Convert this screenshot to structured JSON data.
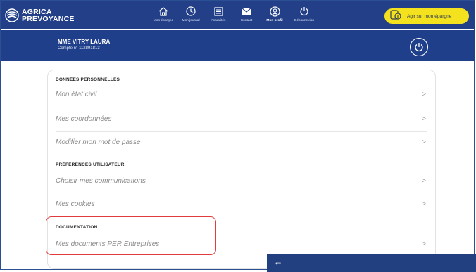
{
  "brand": {
    "line1": "AGRICA",
    "line2": "PRÉVOYANCE"
  },
  "nav": [
    {
      "label": "Mon épargne",
      "icon": "home-icon",
      "active": false
    },
    {
      "label": "Mon journal",
      "icon": "clock-icon",
      "active": false
    },
    {
      "label": "Actualités",
      "icon": "newspaper-icon",
      "active": false
    },
    {
      "label": "Contact",
      "icon": "mail-icon",
      "active": false
    },
    {
      "label": "Mon profil",
      "icon": "user-icon",
      "active": true
    },
    {
      "label": "Déconnexion",
      "icon": "power-icon",
      "active": false
    }
  ],
  "cta": {
    "label": "Agir sur mon épargne",
    "icon": "savings-icon"
  },
  "user": {
    "name": "MME VITRY LAURA",
    "account": "Compte n° 112891813"
  },
  "sections": [
    {
      "title": "DONNÉES PERSONNELLES",
      "items": [
        "Mon état civil",
        "Mes coordonnées",
        "Modifier mon mot de passe"
      ]
    },
    {
      "title": "PRÉFÉRENCES UTILISATEUR",
      "items": [
        "Choisir mes communications",
        "Mes cookies"
      ]
    },
    {
      "title": "DOCUMENTATION",
      "items": [
        "Mes documents PER Entreprises"
      ]
    }
  ],
  "chevron": ">",
  "panel": {
    "back_icon": "arrow-left-icon",
    "back_glyph": "⇐"
  },
  "colors": {
    "header": "#223f88",
    "accent_yellow": "#f3e21d",
    "highlight": "#e23b3b"
  }
}
